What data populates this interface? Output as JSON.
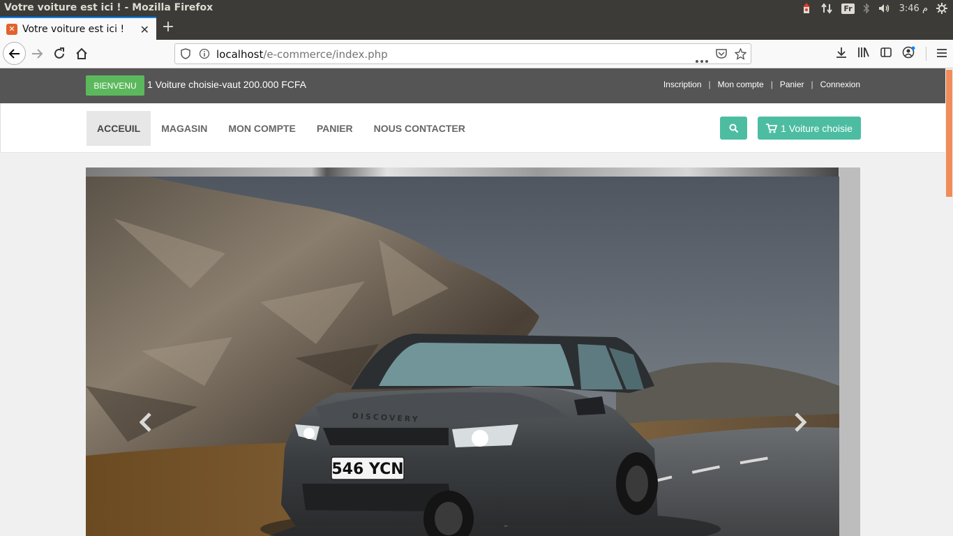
{
  "os": {
    "window_title": "Votre voiture est ici ! - Mozilla Firefox",
    "keyboard_layout": "Fr",
    "clock": "3:46 م"
  },
  "browser": {
    "tab_title": "Votre voiture est ici !",
    "url_host": "localhost",
    "url_path": "/e-commerce/index.php"
  },
  "topbar": {
    "welcome": "BIENVENU",
    "cart_summary": "1 Voiture choisie-vaut 200.000 FCFA",
    "links": [
      "Inscription",
      "Mon compte",
      "Panier",
      "Connexion"
    ]
  },
  "nav": {
    "items": [
      "ACCEUIL",
      "MAGASIN",
      "MON COMPTE",
      "PANIER",
      "NOUS CONTACTER"
    ],
    "active_index": 0,
    "cart_button": "1 Voiture choisie"
  },
  "carousel": {
    "plate": "546 YCN",
    "hood_text": "DISCOVERY"
  },
  "colors": {
    "accent": "#4dbda2",
    "welcome_badge": "#5cb85c",
    "topbar": "#555555"
  }
}
